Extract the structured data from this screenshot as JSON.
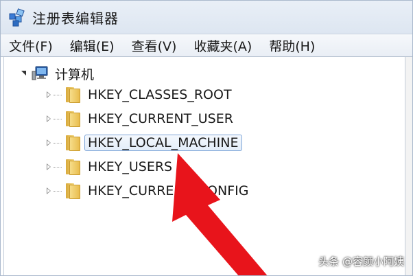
{
  "window": {
    "title": "注册表编辑器"
  },
  "menu": [
    {
      "label": "文件(F)"
    },
    {
      "label": "编辑(E)"
    },
    {
      "label": "查看(V)"
    },
    {
      "label": "收藏夹(A)"
    },
    {
      "label": "帮助(H)"
    }
  ],
  "tree": {
    "root_label": "计算机",
    "keys": [
      {
        "label": "HKEY_CLASSES_ROOT",
        "selected": false
      },
      {
        "label": "HKEY_CURRENT_USER",
        "selected": false
      },
      {
        "label": "HKEY_LOCAL_MACHINE",
        "selected": true
      },
      {
        "label": "HKEY_USERS",
        "selected": false
      },
      {
        "label": "HKEY_CURRENT_CONFIG",
        "selected": false
      }
    ]
  },
  "annotation": {
    "arrow_color": "#e8141b"
  },
  "watermark": {
    "text": "头条 @容颜小阿姨"
  },
  "colors": {
    "folder": "#f3d67c",
    "selection_border": "#7fa6d8"
  }
}
